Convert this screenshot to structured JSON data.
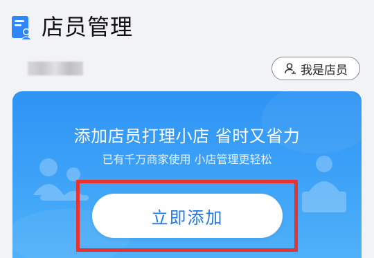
{
  "header": {
    "title": "店员管理",
    "icon": "document-user-icon"
  },
  "user": {
    "name_blurred": true
  },
  "role_button": {
    "label": "我是店员",
    "icon": "person-icon"
  },
  "banner": {
    "title": "添加店员打理小店 省时又省力",
    "subtitle": "已有千万商家使用 小店管理更轻松",
    "cta_label": "立即添加",
    "background_color": "#3ba0f7",
    "cta_text_color": "#1e78e6"
  },
  "annotation": {
    "highlight_color": "#e8322f"
  }
}
